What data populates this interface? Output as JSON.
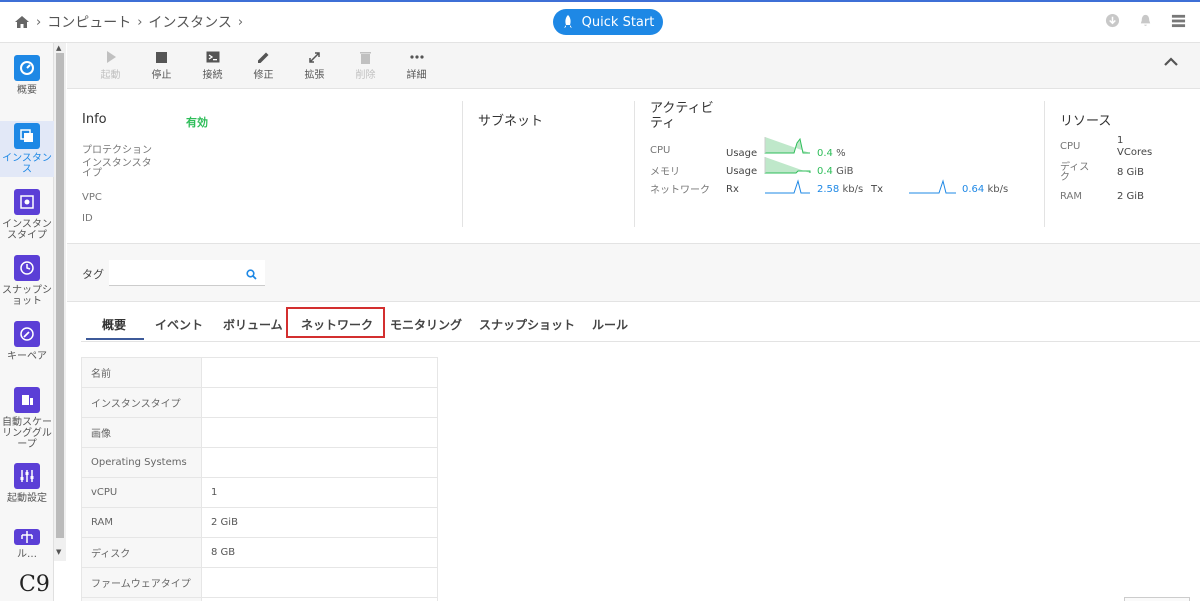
{
  "header": {
    "breadcrumb": [
      "コンピュート",
      "インスタンス"
    ],
    "quick_start": "Quick Start"
  },
  "sidebar": {
    "items": [
      {
        "label": "概要",
        "icon": "dashboard-icon"
      },
      {
        "label": "インスタンス",
        "icon": "instances-icon"
      },
      {
        "label": "インスタンスタイプ",
        "icon": "instance-type-icon"
      },
      {
        "label": "スナップショット",
        "icon": "snapshot-icon"
      },
      {
        "label": "キーペア",
        "icon": "key-pair-icon"
      },
      {
        "label": "自動スケーリンググループ",
        "icon": "autoscaling-icon"
      },
      {
        "label": "起動設定",
        "icon": "launch-config-icon"
      },
      {
        "label": "ル…",
        "icon": "route-icon"
      }
    ],
    "logo": "C9"
  },
  "toolbar": {
    "start": "起動",
    "stop": "停止",
    "connect": "接続",
    "edit": "修正",
    "expand": "拡張",
    "delete": "削除",
    "details": "詳細"
  },
  "info": {
    "title": "Info",
    "status": "有効",
    "protection": "プロテクション",
    "instance_type": "インスタンスタイプ",
    "vpc": "VPC",
    "id": "ID"
  },
  "subnet": {
    "title": "サブネット"
  },
  "activity": {
    "title": "アクティビティ",
    "cpu_label": "CPU",
    "cpu_metric": "Usage",
    "cpu_value": "0.4",
    "cpu_unit": "%",
    "mem_label": "メモリ",
    "mem_metric": "Usage",
    "mem_value": "0.4",
    "mem_unit": "GiB",
    "net_label": "ネットワーク",
    "rx_label": "Rx",
    "rx_value": "2.58",
    "rx_unit": "kb/s",
    "tx_label": "Tx",
    "tx_value": "0.64",
    "tx_unit": "kb/s"
  },
  "resources": {
    "title": "リソース",
    "cpu_label": "CPU",
    "cpu_value_1": "1",
    "cpu_value_2": "VCores",
    "disk_label": "ディスク",
    "disk_value": "8 GiB",
    "ram_label": "RAM",
    "ram_value": "2 GiB"
  },
  "tag": {
    "label": "タグ",
    "placeholder": ""
  },
  "tabs": [
    "概要",
    "イベント",
    "ボリューム",
    "ネットワーク",
    "モニタリング",
    "スナップショット",
    "ルール"
  ],
  "overview_table": [
    {
      "key": "名前",
      "value": ""
    },
    {
      "key": "インスタンスタイプ",
      "value": ""
    },
    {
      "key": "画像",
      "value": ""
    },
    {
      "key": "Operating Systems",
      "value": ""
    },
    {
      "key": "vCPU",
      "value": "1"
    },
    {
      "key": "RAM",
      "value": "2 GiB"
    },
    {
      "key": "ディスク",
      "value": "8 GB"
    },
    {
      "key": "ファームウェアタイプ",
      "value": ""
    },
    {
      "key": "",
      "value": ""
    }
  ],
  "colors": {
    "accent": "#1e88e5",
    "sidebar_icon": "#5b3fd6",
    "active_green": "#2ebd59",
    "highlight": "#d32f2f"
  }
}
